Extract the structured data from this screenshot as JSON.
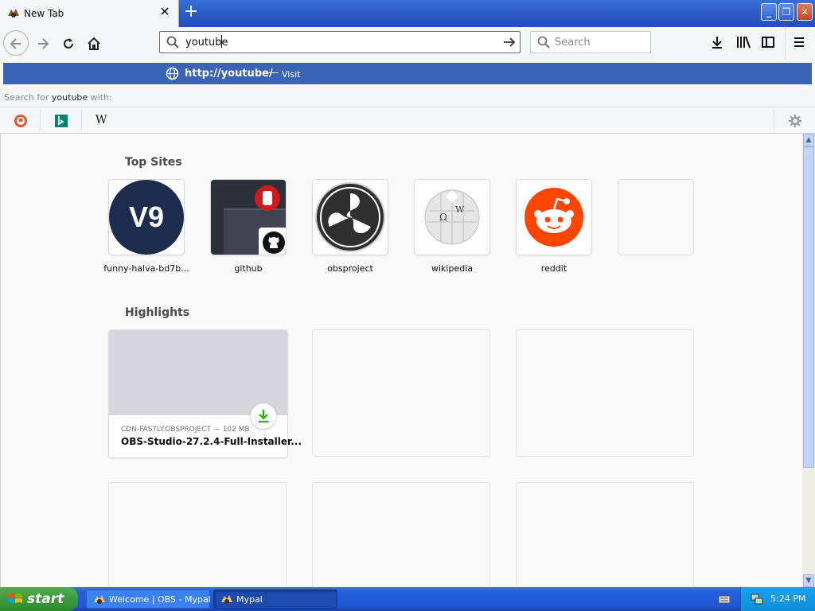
{
  "browser": {
    "tab_title": "New Tab",
    "new_tab_icon": "plus-icon",
    "url_value": "youtube",
    "search_placeholder": "Search",
    "autocomplete": {
      "url_prefix": "http://",
      "url_bold": "youtube/",
      "separator": "—",
      "action": "Visit",
      "search_for_prefix": "Search for",
      "search_for_term": "youtube",
      "search_for_suffix": "with:"
    },
    "engines": [
      "duckduckgo-icon",
      "bing-icon",
      "wikipedia-icon"
    ],
    "wiki_glyph": "W"
  },
  "newtab": {
    "top_sites_title": "Top Sites",
    "top_sites": [
      {
        "label": "funny-halva-bd7b...",
        "tile_text": "V9"
      },
      {
        "label": "github"
      },
      {
        "label": "obsproject"
      },
      {
        "label": "wikipedia"
      },
      {
        "label": "reddit"
      },
      {
        "label": ""
      }
    ],
    "highlights_title": "Highlights",
    "highlight": {
      "source": "CDN-FASTLY.OBSPROJECT — 102 MB",
      "title": "OBS-Studio-27.2.4-Full-Installer..."
    }
  },
  "taskbar": {
    "start_label": "start",
    "tasks": [
      "Welcome | OBS - Mypal",
      "Mypal"
    ],
    "clock": "5:24 PM"
  },
  "colors": {
    "accent": "#3c64b4",
    "titlebar": "#2a58c4",
    "reddit": "#ff4500",
    "v9_bg": "#1d2b4f",
    "download_green": "#12bc00"
  }
}
